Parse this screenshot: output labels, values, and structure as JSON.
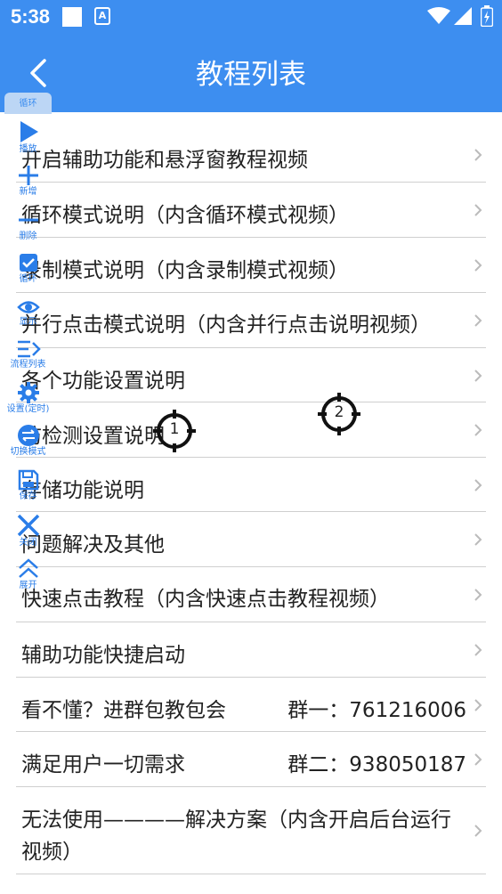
{
  "status_bar": {
    "time": "5:38",
    "notification_icons": [
      "square-icon",
      "a-icon"
    ],
    "right_icons": [
      "wifi-icon",
      "cell-signal-icon",
      "battery-icon"
    ]
  },
  "header": {
    "title": "教程列表",
    "back_icon": "chevron-left-icon"
  },
  "list": [
    {
      "label": "开启辅助功能和悬浮窗教程视频",
      "group": ""
    },
    {
      "label": "循环模式说明（内含循环模式视频）",
      "group": ""
    },
    {
      "label": "录制模式说明（内含录制模式视频）",
      "group": ""
    },
    {
      "label": "并行点击模式说明（内含并行点击说明视频）",
      "group": ""
    },
    {
      "label": "各个功能设置说明",
      "group": ""
    },
    {
      "label": "防检测设置说明",
      "group": ""
    },
    {
      "label": "存储功能说明",
      "group": ""
    },
    {
      "label": "问题解决及其他",
      "group": ""
    },
    {
      "label": "快速点击教程（内含快速点击教程视频）",
      "group": ""
    },
    {
      "label": "辅助功能快捷启动",
      "group": ""
    },
    {
      "label": "看不懂？进群包教包会",
      "group": "群一：761216006"
    },
    {
      "label": "满足用户一切需求",
      "group": "群二：938050187"
    },
    {
      "label": "无法使用————解决方案（内含开启后台运行",
      "label2": "视频）",
      "group": ""
    }
  ],
  "floating_panel": {
    "header": "循环",
    "items": [
      {
        "label": "播放",
        "icon": "play-icon"
      },
      {
        "label": "新增",
        "icon": "plus-icon"
      },
      {
        "label": "删除",
        "icon": "minus-icon"
      },
      {
        "label": "循环",
        "icon": "checkbox-icon"
      },
      {
        "label": "显示",
        "icon": "eye-icon"
      },
      {
        "label": "流程列表",
        "icon": "list-icon"
      },
      {
        "label": "设置(定时)",
        "icon": "gear-icon"
      },
      {
        "label": "切换模式",
        "icon": "switch-icon"
      },
      {
        "label": "保存",
        "icon": "save-icon"
      },
      {
        "label": "关闭",
        "icon": "close-icon"
      },
      {
        "label": "展开",
        "icon": "double-chevron-up-icon"
      }
    ]
  },
  "targets": [
    {
      "label": "1"
    },
    {
      "label": "2"
    }
  ],
  "colors": {
    "primary": "#3d8ef0",
    "panel_tab": "#bcd6f5",
    "divider": "#cfcfcf",
    "text": "#222222"
  }
}
